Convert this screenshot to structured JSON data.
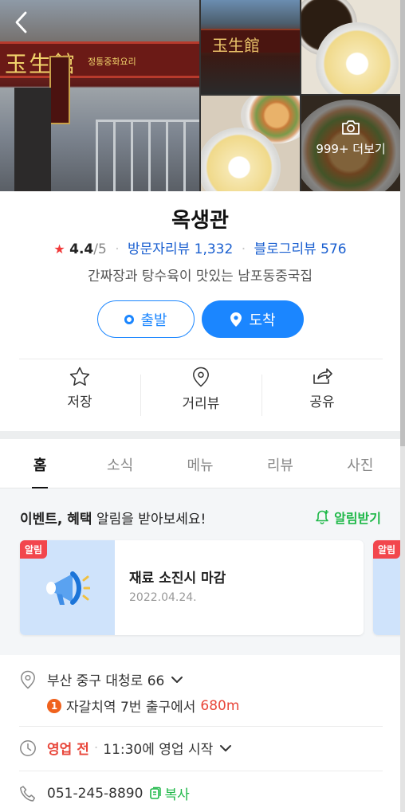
{
  "photos": {
    "more_label": "999+ 더보기",
    "sign_main": "玉生館",
    "sign_sub": "정통중화요리"
  },
  "place": {
    "name": "옥생관",
    "rating": "4.4",
    "rating_max": "/5",
    "visitor_reviews_label": "방문자리뷰 1,332",
    "blog_reviews_label": "블로그리뷰 576",
    "description": "간짜장과 탕수육이 맛있는 남포동중국집"
  },
  "route": {
    "depart_label": "출발",
    "arrive_label": "도착"
  },
  "actions": [
    {
      "label": "저장",
      "icon": "star-icon"
    },
    {
      "label": "거리뷰",
      "icon": "map-pin-icon"
    },
    {
      "label": "공유",
      "icon": "share-icon"
    }
  ],
  "tabs": [
    {
      "label": "홈",
      "active": true
    },
    {
      "label": "소식",
      "active": false
    },
    {
      "label": "메뉴",
      "active": false
    },
    {
      "label": "리뷰",
      "active": false
    },
    {
      "label": "사진",
      "active": false
    }
  ],
  "events": {
    "heading_bold": "이벤트, 혜택",
    "heading_rest": " 알림을 받아보세요!",
    "subscribe_label": "알림받기",
    "cards": [
      {
        "badge": "알림",
        "title": "재료 소진시 마감",
        "date": "2022.04.24."
      },
      {
        "badge": "알림"
      }
    ]
  },
  "details": {
    "address": "부산 중구 대청로 66",
    "subway_line": "1",
    "subway_text": "자갈치역 7번 출구에서",
    "subway_distance": "680m",
    "status": "영업 전",
    "hours_text": "11:30에 영업 시작",
    "phone": "051-245-8890",
    "copy_label": "복사"
  },
  "colors": {
    "accent_blue": "#1b86ff",
    "green": "#1eb848",
    "red": "#e8463a"
  }
}
